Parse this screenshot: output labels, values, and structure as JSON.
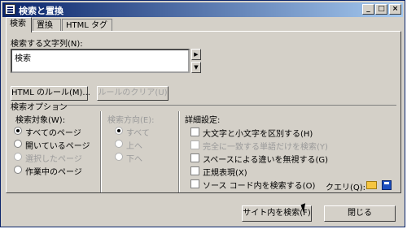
{
  "window": {
    "title": "検索と置換",
    "min_label": "_",
    "max_label": "□",
    "close_label": "×"
  },
  "tabs": [
    "検索",
    "置換",
    "HTML タグ"
  ],
  "search": {
    "label": "検索する文字列(N):",
    "value": "検索",
    "spin_up": "▶",
    "spin_down": "▼"
  },
  "buttons": {
    "html_rules": "HTML のルール(M)...",
    "clear_rules": "ルールのクリア(U)",
    "find_in_site": "サイト内を検索(F)",
    "close": "閉じる"
  },
  "options": {
    "title": "検索オプション",
    "target": {
      "label": "検索対象(W):",
      "items": [
        {
          "label": "すべてのページ",
          "checked": true,
          "enabled": true
        },
        {
          "label": "開いているページ",
          "checked": false,
          "enabled": true
        },
        {
          "label": "選択したページ",
          "checked": false,
          "enabled": false
        },
        {
          "label": "作業中のページ",
          "checked": false,
          "enabled": true
        }
      ]
    },
    "direction": {
      "label": "検索方向(E):",
      "items": [
        {
          "label": "すべて",
          "checked": true,
          "enabled": false
        },
        {
          "label": "上へ",
          "checked": false,
          "enabled": false
        },
        {
          "label": "下へ",
          "checked": false,
          "enabled": false
        }
      ]
    },
    "advanced": {
      "label": "詳細設定:",
      "items": [
        {
          "label": "大文字と小文字を区別する(H)",
          "enabled": true
        },
        {
          "label": "完全に一致する単語だけを検索(Y)",
          "enabled": false
        },
        {
          "label": "スペースによる違いを無視する(G)",
          "enabled": true
        },
        {
          "label": "正規表現(X)",
          "enabled": true
        },
        {
          "label": "ソース コード内を検索する(O)",
          "enabled": true
        }
      ]
    },
    "query_label": "クエリ(Q):"
  }
}
